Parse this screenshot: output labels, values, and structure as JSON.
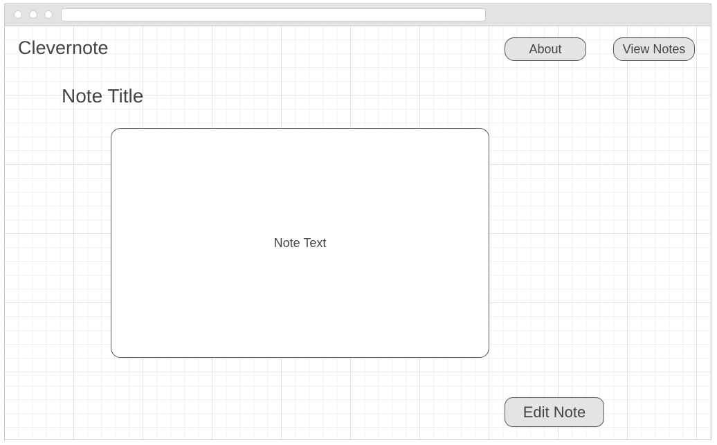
{
  "app": {
    "brand": "Clevernote"
  },
  "nav": {
    "about_label": "About",
    "view_notes_label": "View Notes"
  },
  "note": {
    "title": "Note Title",
    "text": "Note Text"
  },
  "actions": {
    "edit_label": "Edit Note"
  },
  "colors": {
    "button_fill": "#e4e4e4",
    "text": "#444444",
    "grid_major": "#e2e2e2",
    "grid_minor": "#f1f1f1"
  }
}
